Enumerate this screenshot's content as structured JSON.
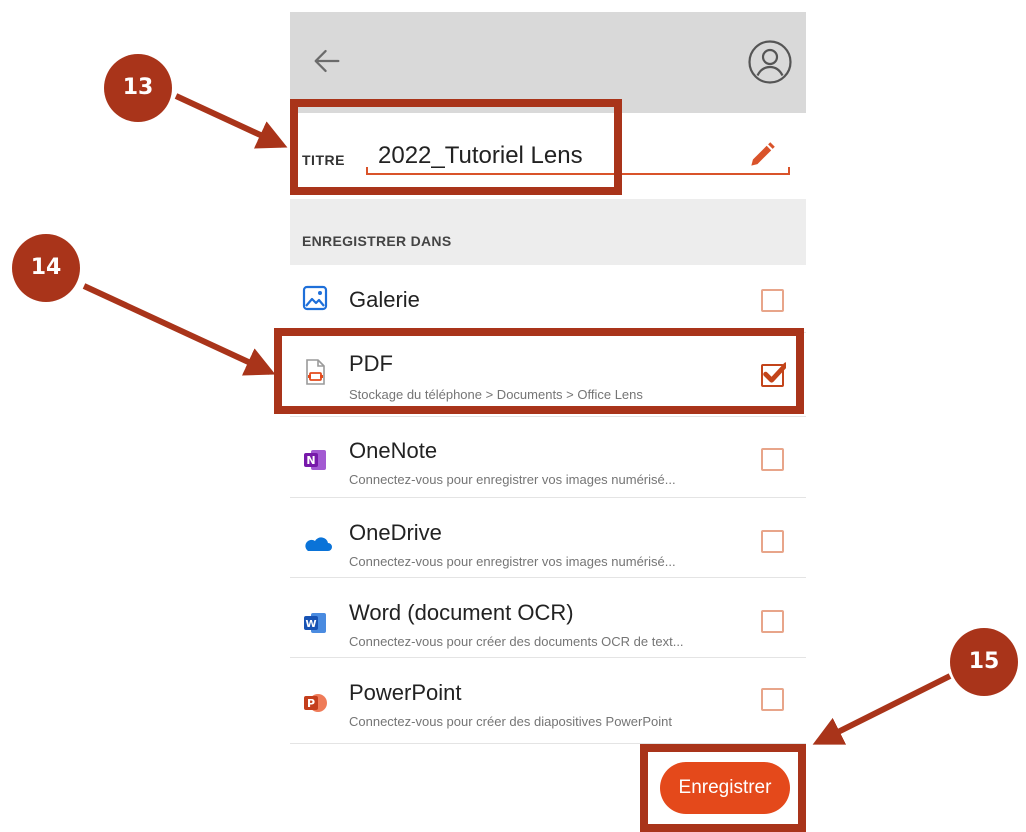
{
  "header": {
    "back_icon": "arrow-left-icon",
    "profile_icon": "user-circle-icon"
  },
  "title_field": {
    "label": "TITRE",
    "value": "2022_Tutoriel Lens",
    "edit_icon": "pencil-icon"
  },
  "save_section": {
    "label": "ENREGISTRER DANS"
  },
  "destinations": [
    {
      "name": "Galerie",
      "subtitle": "",
      "icon": "gallery-icon",
      "checked": false
    },
    {
      "name": "PDF",
      "subtitle": "Stockage du téléphone > Documents > Office Lens",
      "icon": "pdf-file-icon",
      "checked": true
    },
    {
      "name": "OneNote",
      "subtitle": "Connectez-vous pour enregistrer vos images numérisé...",
      "icon": "onenote-icon",
      "checked": false
    },
    {
      "name": "OneDrive",
      "subtitle": "Connectez-vous pour enregistrer vos images numérisé...",
      "icon": "onedrive-icon",
      "checked": false
    },
    {
      "name": "Word (document OCR)",
      "subtitle": "Connectez-vous pour créer des documents OCR de text...",
      "icon": "word-icon",
      "checked": false
    },
    {
      "name": "PowerPoint",
      "subtitle": "Connectez-vous pour créer des diapositives PowerPoint",
      "icon": "powerpoint-icon",
      "checked": false
    }
  ],
  "save_button": {
    "label": "Enregistrer"
  },
  "annotations": {
    "step_13": "13",
    "step_14": "14",
    "step_15": "15"
  },
  "colors": {
    "accent": "#e4491b",
    "highlight": "#a9341a",
    "topbar": "#d9d9d9"
  }
}
